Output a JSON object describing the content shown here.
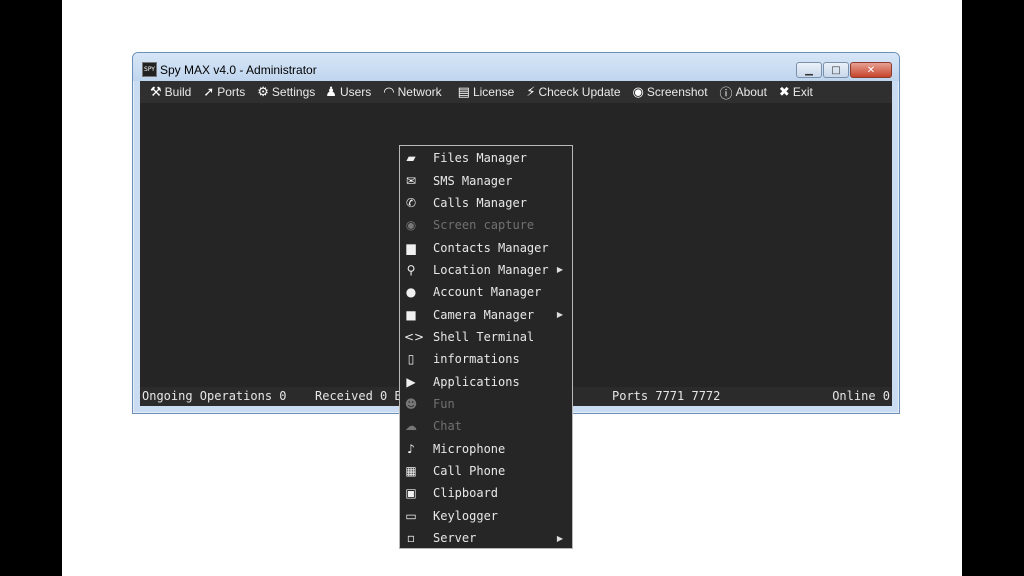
{
  "window": {
    "title": "Spy MAX v4.0 - Administrator",
    "app_icon_text": "SPY",
    "buttons": {
      "minimize": "▁",
      "maximize": "□",
      "close": "✕"
    }
  },
  "menubar": {
    "items": [
      {
        "label": "Build",
        "icon": "⚒"
      },
      {
        "label": "Ports",
        "icon": "➚"
      },
      {
        "label": "Settings",
        "icon": "⚙"
      },
      {
        "label": "Users",
        "icon": "♟"
      },
      {
        "label": "Network",
        "icon": "◠"
      },
      {
        "label": "License",
        "icon": "▤"
      },
      {
        "label": "Chceck Update",
        "icon": "⚡"
      },
      {
        "label": "Screenshot",
        "icon": "◉"
      },
      {
        "label": "About",
        "icon": "ⓘ"
      },
      {
        "label": "Exit",
        "icon": "✖"
      }
    ]
  },
  "statusbar": {
    "operations": "Ongoing Operations 0",
    "received": "Received 0 B",
    "ports": "Ports 7771 7772",
    "online": "Online 0"
  },
  "context_menu": {
    "items": [
      {
        "label": "Files Manager",
        "icon": "▰"
      },
      {
        "label": "SMS Manager",
        "icon": "✉"
      },
      {
        "label": "Calls Manager",
        "icon": "✆"
      },
      {
        "label": "Screen capture",
        "icon": "◉"
      },
      {
        "label": "Contacts Manager",
        "icon": "▆"
      },
      {
        "label": "Location Manager",
        "icon": "⚲",
        "arrow": "▶"
      },
      {
        "label": "Account Manager",
        "icon": "●"
      },
      {
        "label": "Camera Manager",
        "icon": "■",
        "arrow": "▶"
      },
      {
        "label": "Shell Terminal",
        "icon": "<>"
      },
      {
        "label": "informations",
        "icon": "▯"
      },
      {
        "label": "Applications",
        "icon": "▶"
      },
      {
        "label": "Fun",
        "icon": "☻"
      },
      {
        "label": "Chat",
        "icon": "☁"
      },
      {
        "label": "Microphone",
        "icon": "♪"
      },
      {
        "label": "Call Phone",
        "icon": "▦"
      },
      {
        "label": "Clipboard",
        "icon": "▣"
      },
      {
        "label": "Keylogger",
        "icon": "▭"
      },
      {
        "label": "Server",
        "icon": "▫",
        "arrow": "▶"
      }
    ]
  }
}
